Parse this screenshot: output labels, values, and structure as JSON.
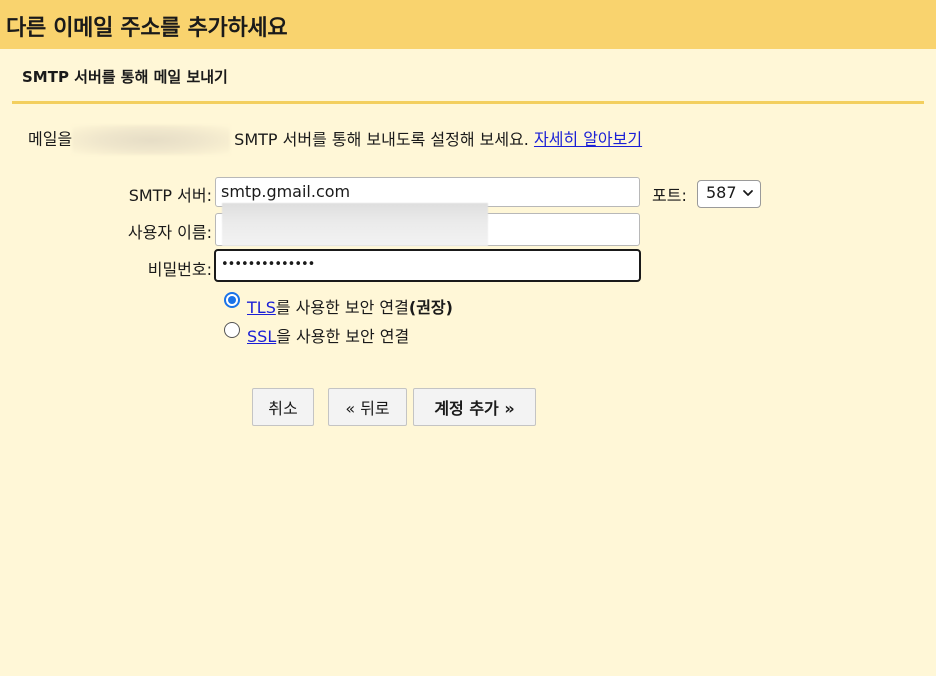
{
  "header": {
    "title": "다른 이메일 주소를 추가하세요"
  },
  "section": {
    "title": "SMTP 서버를 통해 메일 보내기"
  },
  "intro": {
    "prefix": "메일을",
    "text": "SMTP 서버를 통해 보내도록 설정해 보세요.",
    "learn_more_link": "자세히 알아보기"
  },
  "form": {
    "smtp_server_label": "SMTP 서버:",
    "smtp_server_value": "smtp.gmail.com",
    "port_label": "포트:",
    "port_value": "587",
    "username_label": "사용자 이름:",
    "password_label": "비밀번호:",
    "password_mask": "••••••••••••••"
  },
  "security": {
    "tls_link": "TLS",
    "tls_text": "를 사용한 보안 연결",
    "tls_recommended": "(권장)",
    "ssl_link": "SSL",
    "ssl_text": "을 사용한 보안 연결",
    "selected": "tls"
  },
  "buttons": {
    "cancel": "취소",
    "back": "« 뒤로",
    "add_account": "계정 추가 »"
  },
  "colors": {
    "header_bg": "#f9d36e",
    "page_bg": "#fff7d7",
    "link": "#1a1fd6",
    "radio_accent": "#1a73e8"
  }
}
